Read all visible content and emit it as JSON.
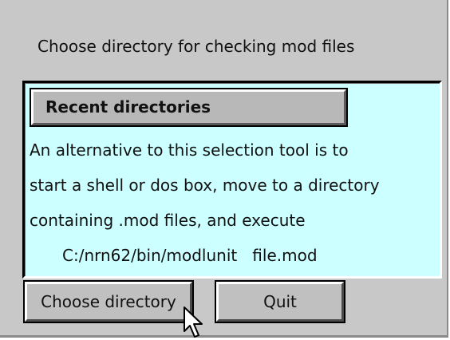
{
  "dialog": {
    "heading": "Choose directory for checking mod files",
    "recent_button_label": "Recent directories",
    "help_lines": [
      "An alternative to this selection tool is to",
      "start a shell or dos box, move to a directory",
      "containing .mod files, and execute"
    ],
    "command_line": "C:/nrn62/bin/modlunit   file.mod",
    "choose_button_label": "Choose directory",
    "quit_button_label": "Quit"
  },
  "colors": {
    "window_background": "#c8c8c8",
    "panel_background": "#ccffff",
    "button_face": "#c0c0c0"
  },
  "icons": {
    "cursor": "arrow-pointer-icon"
  }
}
